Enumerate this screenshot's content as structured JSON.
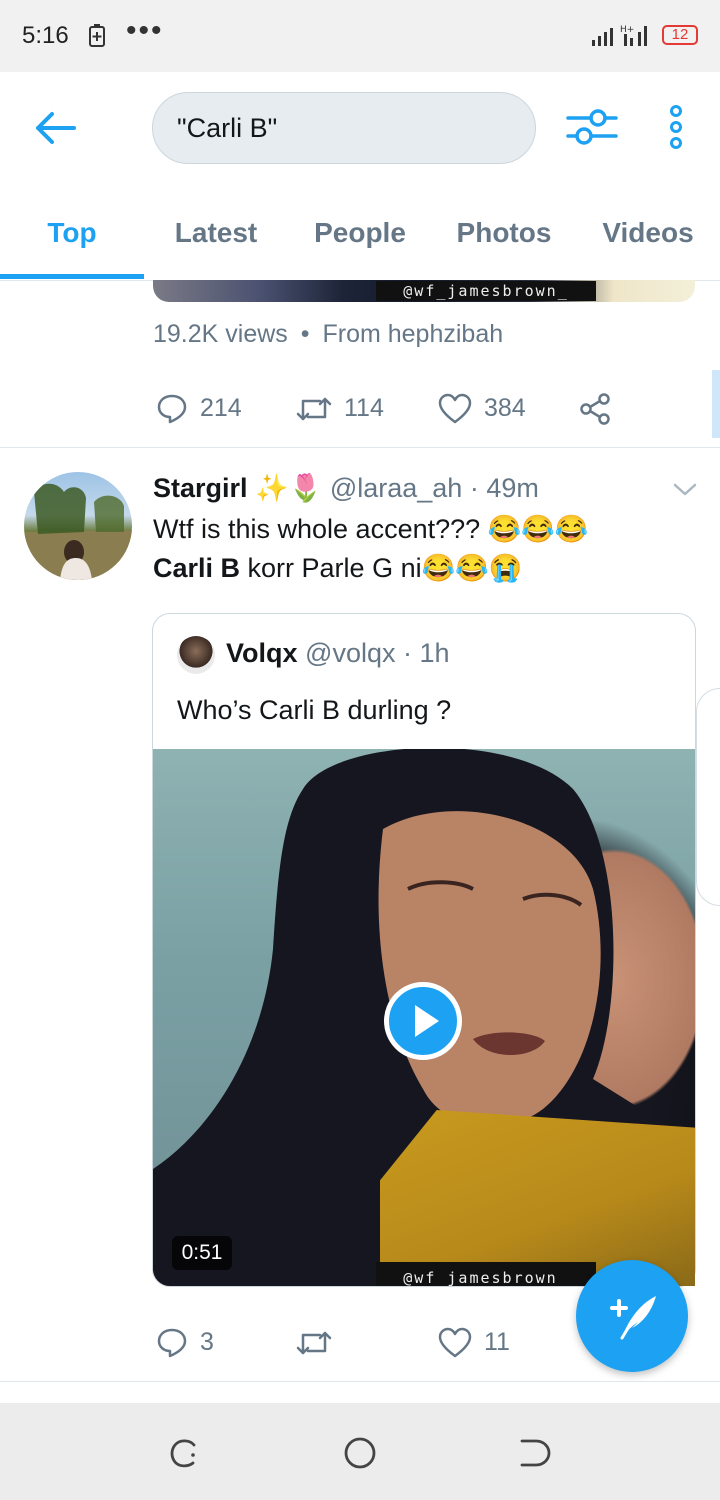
{
  "status_bar": {
    "time": "5:16",
    "dots": "•••",
    "battery": "12",
    "accent_battery": "#e53935"
  },
  "header": {
    "search_query": "\"Carli B\""
  },
  "tabs": [
    {
      "label": "Top",
      "active": true
    },
    {
      "label": "Latest",
      "active": false
    },
    {
      "label": "People",
      "active": false
    },
    {
      "label": "Photos",
      "active": false
    },
    {
      "label": "Videos",
      "active": false
    }
  ],
  "tweet1": {
    "watermark": "@wf_jamesbrown_",
    "views": "19.2K views",
    "separator": "•",
    "source": "From hephzibah",
    "replies": "214",
    "retweets": "114",
    "likes": "384"
  },
  "tweet2": {
    "name": "Stargirl",
    "name_emoji": "✨🌷",
    "handle": "@laraa_ah",
    "time": "· 49m",
    "line1": "Wtf is this whole accent??? 😂😂😂",
    "line2_bold": "Carli B",
    "line2_rest": " korr Parle G ni😂😂😭",
    "quote": {
      "name": "Volqx",
      "handle": "@volqx",
      "time": "· 1h",
      "text": "Who’s Carli B durling ?",
      "duration": "0:51",
      "watermark": "@wf_jamesbrown_"
    },
    "replies": "3",
    "retweets": "",
    "likes": "11"
  },
  "colors": {
    "accent": "#1da1f2",
    "secondary_text": "#657786"
  },
  "icons": [
    "back-arrow-icon",
    "filter-icon",
    "more-vertical-icon",
    "reply-icon",
    "retweet-icon",
    "like-icon",
    "share-icon",
    "chevron-down-icon",
    "play-icon",
    "compose-icon",
    "recent-apps-icon",
    "home-icon",
    "back-nav-icon"
  ]
}
